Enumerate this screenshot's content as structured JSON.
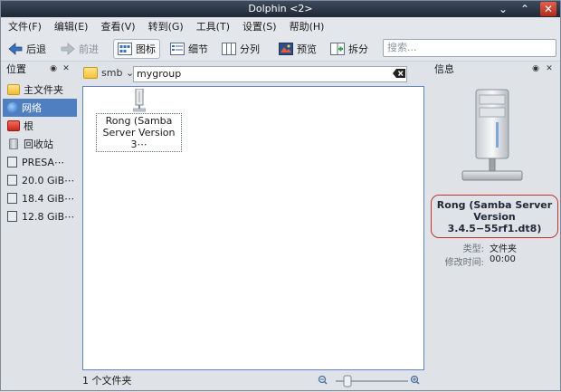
{
  "window": {
    "title": "Dolphin <2>"
  },
  "menu": [
    "文件(F)",
    "编辑(E)",
    "查看(V)",
    "转到(G)",
    "工具(T)",
    "设置(S)",
    "帮助(H)"
  ],
  "toolbar": {
    "back": "后退",
    "forward": "前进",
    "icons": "图标",
    "details": "细节",
    "columns": "分列",
    "preview": "预览",
    "split": "拆分",
    "search_placeholder": "搜索..."
  },
  "places": {
    "title": "位置",
    "items": [
      "主文件夹",
      "网络",
      "根",
      "回收站",
      "PRESA⋯",
      "20.0 GiB⋯",
      "18.4 GiB⋯",
      "12.8 GiB⋯"
    ]
  },
  "location": {
    "segment": "smb",
    "path": "mygroup"
  },
  "files": [
    {
      "name": "Rong (Samba Server Version 3⋯"
    }
  ],
  "status": {
    "text": "1 个文件夹"
  },
  "info": {
    "title": "信息",
    "name": "Rong (Samba Server Version 3.4.5−55rf1.dt8)",
    "type_label": "类型:",
    "type_value": "文件夹",
    "modified_label": "修改时间:",
    "modified_value": "00:00"
  },
  "colors": {
    "accent": "#4f7fc0",
    "highlight_border": "#c63030"
  }
}
